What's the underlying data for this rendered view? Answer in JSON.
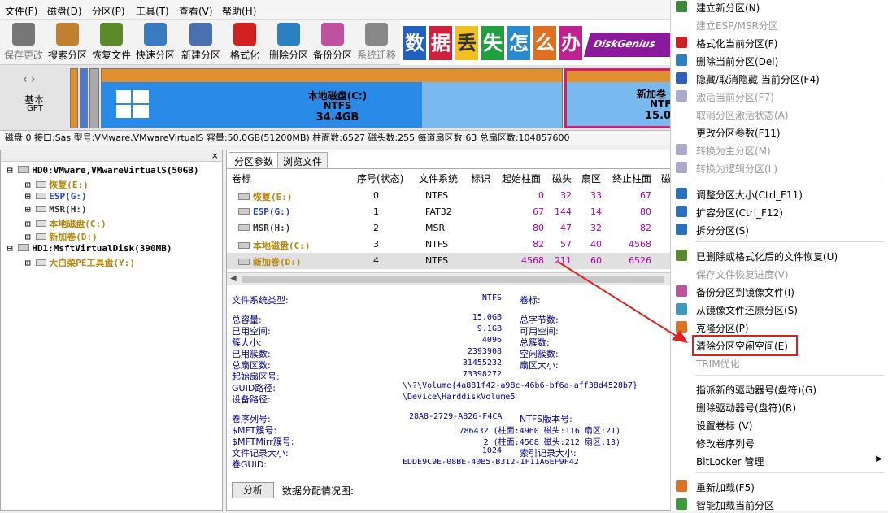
{
  "menu": [
    "文件(F)",
    "磁盘(D)",
    "分区(P)",
    "工具(T)",
    "查看(V)",
    "帮助(H)"
  ],
  "toolbar": [
    {
      "label": "保存更改",
      "icon": "save-icon",
      "color": "#777",
      "disabled": true
    },
    {
      "label": "搜索分区",
      "icon": "search-icon",
      "color": "#c08030",
      "disabled": false
    },
    {
      "label": "恢复文件",
      "icon": "recover-icon",
      "color": "#5a8a2a",
      "disabled": false
    },
    {
      "label": "快速分区",
      "icon": "quick-partition-icon",
      "color": "#3a7ac0",
      "disabled": false
    },
    {
      "label": "新建分区",
      "icon": "new-partition-icon",
      "color": "#4a70b0",
      "disabled": false
    },
    {
      "label": "格式化",
      "icon": "format-icon",
      "color": "#d02020",
      "disabled": false
    },
    {
      "label": "删除分区",
      "icon": "delete-icon",
      "color": "#2a80c0",
      "disabled": false
    },
    {
      "label": "备份分区",
      "icon": "backup-icon",
      "color": "#c050a0",
      "disabled": false
    },
    {
      "label": "系统迁移",
      "icon": "migrate-icon",
      "color": "#888",
      "disabled": true
    }
  ],
  "banner": {
    "chars": [
      "数",
      "据",
      "丢",
      "失",
      "怎",
      "么",
      "办"
    ],
    "brand": "DiskGenius"
  },
  "disk_nav": {
    "type": "基本",
    "style": "GPT"
  },
  "partitions_bar": [
    {
      "name": "本地磁盘(C:)",
      "fs": "NTFS",
      "size": "34.4GB"
    },
    {
      "name": "新加卷",
      "fs": "NTF",
      "size": "15.0"
    }
  ],
  "disk_info": "磁盘 0 接口:Sas  型号:VMware,VMwareVirtualS  容量:50.0GB(51200MB)  柱面数:6527  磁头数:255  每道扇区数:63  总扇区数:104857600",
  "tree": {
    "disk0": "HD0:VMware,VMwareVirtualS(50GB)",
    "disk0_parts": [
      {
        "label": "恢复(E:)",
        "color": "#b8860b"
      },
      {
        "label": "ESP(G:)",
        "color": "#2040c0"
      },
      {
        "label": "MSR(H:)",
        "color": "#333"
      },
      {
        "label": "本地磁盘(C:)",
        "color": "#b8860b"
      },
      {
        "label": "新加卷(D:)",
        "color": "#b8860b"
      }
    ],
    "disk1": "HD1:MsftVirtualDisk(390MB)",
    "disk1_parts": [
      {
        "label": "大白菜PE工具盘(Y:)",
        "color": "#b8860b"
      }
    ]
  },
  "tabs": [
    "分区参数",
    "浏览文件"
  ],
  "table": {
    "headers": [
      "卷标",
      "序号(状态)",
      "文件系统",
      "标识",
      "起始柱面",
      "磁头",
      "扇区",
      "终止柱面",
      "磁"
    ],
    "rows": [
      {
        "label": "恢复(E:)",
        "no": "0",
        "fs": "NTFS",
        "id": "",
        "start": "0",
        "head": "32",
        "sec": "33",
        "end": "67",
        "color": "#b8860b"
      },
      {
        "label": "ESP(G:)",
        "no": "1",
        "fs": "FAT32",
        "id": "",
        "start": "67",
        "head": "144",
        "sec": "14",
        "end": "80",
        "color": "#2040c0"
      },
      {
        "label": "MSR(H:)",
        "no": "2",
        "fs": "MSR",
        "id": "",
        "start": "80",
        "head": "47",
        "sec": "32",
        "end": "82",
        "color": "#333"
      },
      {
        "label": "本地磁盘(C:)",
        "no": "3",
        "fs": "NTFS",
        "id": "",
        "start": "82",
        "head": "57",
        "sec": "40",
        "end": "4568",
        "color": "#b8860b"
      },
      {
        "label": "新加卷(D:)",
        "no": "4",
        "fs": "NTFS",
        "id": "",
        "start": "4568",
        "head": "211",
        "sec": "60",
        "end": "6526",
        "color": "#b8860b"
      }
    ]
  },
  "details": {
    "fs_type_label": "文件系统类型:",
    "fs_type": "NTFS",
    "vol_label": "卷标:",
    "left": [
      [
        "总容量:",
        "15.0GB"
      ],
      [
        "已用空间:",
        "9.1GB"
      ],
      [
        "簇大小:",
        "4096"
      ],
      [
        "已用簇数:",
        "2393908"
      ],
      [
        "总扇区数:",
        "31455232"
      ],
      [
        "起始扇区号:",
        "73398272"
      ]
    ],
    "right": [
      "总字节数:",
      "可用空间:",
      "总簇数:",
      "空闲簇数:",
      "扇区大小:"
    ],
    "guid_path_label": "GUID路径:",
    "guid_path": "\\\\?\\Volume{4a881f42-a98c-46b6-bf6a-aff38d4528b7}",
    "dev_path_label": "设备路径:",
    "dev_path": "\\Device\\HarddiskVolume5",
    "serial_label": "卷序列号:",
    "serial": "28A8-2729-A826-F4CA",
    "ntfs_ver_label": "NTFS版本号:",
    "mft_label": "$MFT簇号:",
    "mft": "786432 (柱面:4960 磁头:116 扇区:21)",
    "mftmirr_label": "$MFTMirr簇号:",
    "mftmirr": "2 (柱面:4568 磁头:212 扇区:13)",
    "frs_label": "文件记录大小:",
    "frs": "1024",
    "idx_label": "索引记录大小:",
    "vguid_label": "卷GUID:",
    "vguid": "EDDE9C9E-08BE-40B5-B312-1F11A6EF9F42",
    "analyze": "分析",
    "map_label": "数据分配情况图:"
  },
  "context_menu": [
    {
      "label": "建立新分区(N)",
      "disabled": false,
      "icon": "new-partition-icon",
      "color": "#3a8a3a"
    },
    {
      "label": "建立ESP/MSR分区",
      "disabled": true,
      "icon": "",
      "color": ""
    },
    {
      "label": "格式化当前分区(F)",
      "disabled": false,
      "icon": "format-icon",
      "color": "#d02020"
    },
    {
      "label": "删除当前分区(Del)",
      "disabled": false,
      "icon": "delete-icon",
      "color": "#2a80c0"
    },
    {
      "label": "隐藏/取消隐藏 当前分区(F4)",
      "disabled": false,
      "icon": "hide-icon",
      "color": "#2a60c0"
    },
    {
      "label": "激活当前分区(F7)",
      "disabled": true,
      "icon": "activate-icon",
      "color": "#aac"
    },
    {
      "label": "取消分区激活状态(A)",
      "disabled": true,
      "icon": "",
      "color": ""
    },
    {
      "label": "更改分区参数(F11)",
      "disabled": false,
      "icon": "",
      "color": ""
    },
    {
      "label": "转换为主分区(M)",
      "disabled": true,
      "icon": "convert-icon",
      "color": "#aac"
    },
    {
      "label": "转换为逻辑分区(L)",
      "disabled": true,
      "icon": "convert-icon",
      "color": "#aac"
    },
    {
      "label": "调整分区大小(Ctrl_F11)",
      "disabled": false,
      "icon": "resize-icon",
      "color": "#2a70c0"
    },
    {
      "label": "扩容分区(Ctrl_F12)",
      "disabled": false,
      "icon": "extend-icon",
      "color": "#2a70c0"
    },
    {
      "label": "拆分分区(S)",
      "disabled": false,
      "icon": "split-icon",
      "color": "#2a70c0"
    },
    {
      "label": "已删除或格式化后的文件恢复(U)",
      "disabled": false,
      "icon": "recover-icon",
      "color": "#5a8a2a"
    },
    {
      "label": "保存文件恢复进度(V)",
      "disabled": true,
      "icon": "",
      "color": ""
    },
    {
      "label": "备份分区到镜像文件(I)",
      "disabled": false,
      "icon": "backup-icon",
      "color": "#c050a0"
    },
    {
      "label": "从镜像文件还原分区(S)",
      "disabled": false,
      "icon": "restore-icon",
      "color": "#3a9ac0"
    },
    {
      "label": "克隆分区(P)",
      "disabled": false,
      "icon": "clone-icon",
      "color": "#e07020"
    },
    {
      "label": "清除分区空闲空间(E)",
      "disabled": false,
      "icon": "",
      "color": "",
      "highlight": true
    },
    {
      "label": "TRIM优化",
      "disabled": true,
      "icon": "",
      "color": ""
    },
    {
      "label": "指派新的驱动器号(盘符)(G)",
      "disabled": false,
      "icon": "",
      "color": ""
    },
    {
      "label": "删除驱动器号(盘符)(R)",
      "disabled": false,
      "icon": "",
      "color": ""
    },
    {
      "label": "设置卷标 (V)",
      "disabled": false,
      "icon": "",
      "color": ""
    },
    {
      "label": "修改卷序列号",
      "disabled": false,
      "icon": "",
      "color": ""
    },
    {
      "label": "BitLocker 管理",
      "disabled": false,
      "icon": "",
      "color": "",
      "submenu": true
    },
    {
      "label": "重新加载(F5)",
      "disabled": false,
      "icon": "reload-icon",
      "color": "#e07020"
    },
    {
      "label": "智能加载当前分区",
      "disabled": false,
      "icon": "smart-load-icon",
      "color": "#3a9a3a"
    }
  ],
  "colors": {
    "highlight_box": "#e02020",
    "arrow": "#e02020",
    "partition_c": "#2a8ae8",
    "partition_d_border": "#d0206a"
  }
}
